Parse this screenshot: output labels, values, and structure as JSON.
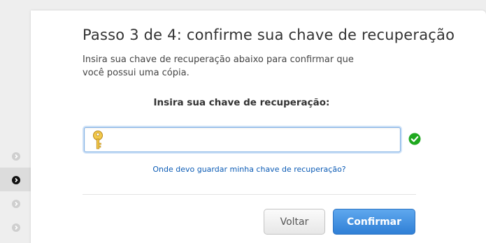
{
  "title": "Passo 3 de 4: confirme sua chave de recuperação",
  "description": "Insira sua chave de recuperação abaixo para confirmar que você possui uma cópia.",
  "field": {
    "label": "Insira sua chave de recuperação:",
    "value": "",
    "valid": true
  },
  "help_link": "Onde devo guardar minha chave de recuperação?",
  "buttons": {
    "back": "Voltar",
    "confirm": "Confirmar"
  },
  "steps": [
    {
      "state": "inactive"
    },
    {
      "state": "current"
    },
    {
      "state": "inactive"
    },
    {
      "state": "inactive"
    }
  ],
  "colors": {
    "accent": "#2f7fd6",
    "link": "#0b5bb5",
    "success": "#1fa81f",
    "key": "#e3b12c"
  },
  "icons": {
    "step": "chevron-right-circle-icon",
    "input": "key-icon",
    "status": "checkmark-circle-icon"
  }
}
